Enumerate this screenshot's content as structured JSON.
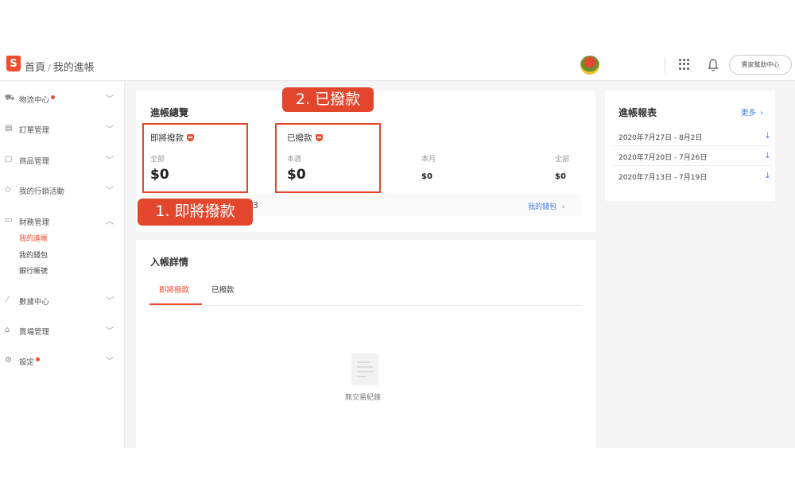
{
  "header": {
    "logo_letter": "S",
    "breadcrumb_home": "首頁",
    "breadcrumb_sep": "/",
    "breadcrumb_current": "我的進帳",
    "help_button": "賣家幫助中心"
  },
  "sidebar": {
    "items": [
      {
        "label": "物流中心",
        "icon": "truck-icon",
        "dot": true
      },
      {
        "label": "訂單管理",
        "icon": "clipboard-icon",
        "dot": false
      },
      {
        "label": "商品管理",
        "icon": "box-icon",
        "dot": false
      },
      {
        "label": "我的行銷活動",
        "icon": "tag-icon",
        "dot": false
      },
      {
        "label": "財務管理",
        "icon": "wallet-icon",
        "dot": false
      },
      {
        "label": "數據中心",
        "icon": "chart-icon",
        "dot": false
      },
      {
        "label": "賣場管理",
        "icon": "store-icon",
        "dot": false
      },
      {
        "label": "設定",
        "icon": "gear-icon",
        "dot": true
      }
    ],
    "finance_sub": [
      "我的進帳",
      "我的錢包",
      "銀行帳號"
    ]
  },
  "overview": {
    "title": "進帳總覽",
    "pending": {
      "label": "即將撥款",
      "period": "全部",
      "amount": "$0"
    },
    "released": {
      "label": "已撥款",
      "week_label": "本週",
      "week_amount": "$0",
      "month_label": "本月",
      "month_amount": "$0",
      "all_label": "全部",
      "all_amount": "$0"
    },
    "partial_digit": "3",
    "wallet_link": "我的錢包"
  },
  "callouts": {
    "one": "1. 即將撥款",
    "two": "2. 已撥款"
  },
  "details": {
    "title": "入帳詳情",
    "tabs": [
      "即將撥款",
      "已撥款"
    ],
    "empty_text": "無交易紀錄"
  },
  "reports": {
    "title": "進帳報表",
    "more_link": "更多",
    "rows": [
      "2020年7月27日 - 8月2日",
      "2020年7月20日 - 7月26日",
      "2020年7月13日 - 7月19日"
    ]
  },
  "colors": {
    "brand": "#ee4d2d",
    "callout": "#e2472d",
    "link": "#3b7ddd"
  }
}
